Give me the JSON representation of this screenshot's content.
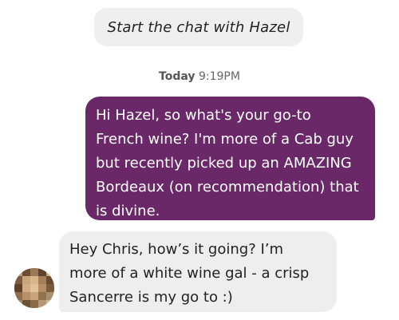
{
  "chat": {
    "start_prompt": "Start the chat with Hazel",
    "timestamp": {
      "day": "Today",
      "time": "9:19PM"
    },
    "messages": [
      {
        "direction": "outgoing",
        "text": "Hi Hazel, so what's your go-to\nFrench wine? I'm more of a Cab guy\nbut recently picked up an AMAZING\nBordeaux (on recommendation) that\nis divine."
      },
      {
        "direction": "incoming",
        "text": "Hey Chris, how’s it going? I’m\nmore of a white wine gal - a crisp\nSancerre is my go to :)"
      }
    ],
    "colors": {
      "outgoing_bubble": "#6a2869",
      "incoming_bubble": "#eeeeee",
      "start_pill": "#efefef"
    }
  }
}
